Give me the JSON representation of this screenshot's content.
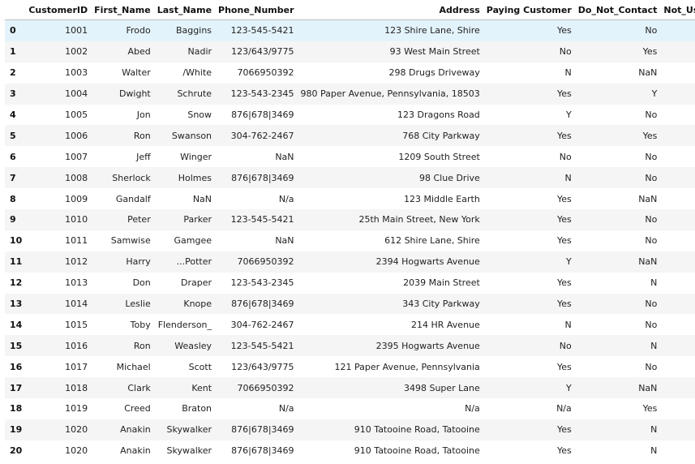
{
  "table": {
    "columns": [
      "",
      "CustomerID",
      "First_Name",
      "Last_Name",
      "Phone_Number",
      "Address",
      "Paying Customer",
      "Do_Not_Contact",
      "Not_Useful_Column"
    ],
    "rows": [
      {
        "index": "0",
        "cid": "1001",
        "first": "Frodo",
        "last": "Baggins",
        "phone": "123-545-5421",
        "address": "123 Shire Lane, Shire",
        "paying": "Yes",
        "dnc": "No",
        "nuc": "True"
      },
      {
        "index": "1",
        "cid": "1002",
        "first": "Abed",
        "last": "Nadir",
        "phone": "123/643/9775",
        "address": "93 West Main Street",
        "paying": "No",
        "dnc": "Yes",
        "nuc": "False"
      },
      {
        "index": "2",
        "cid": "1003",
        "first": "Walter",
        "last": "/White",
        "phone": "7066950392",
        "address": "298 Drugs Driveway",
        "paying": "N",
        "dnc": "NaN",
        "nuc": "True"
      },
      {
        "index": "3",
        "cid": "1004",
        "first": "Dwight",
        "last": "Schrute",
        "phone": "123-543-2345",
        "address": "980 Paper Avenue, Pennsylvania, 18503",
        "paying": "Yes",
        "dnc": "Y",
        "nuc": "True"
      },
      {
        "index": "4",
        "cid": "1005",
        "first": "Jon",
        "last": "Snow",
        "phone": "876|678|3469",
        "address": "123 Dragons Road",
        "paying": "Y",
        "dnc": "No",
        "nuc": "True"
      },
      {
        "index": "5",
        "cid": "1006",
        "first": "Ron",
        "last": "Swanson",
        "phone": "304-762-2467",
        "address": "768 City Parkway",
        "paying": "Yes",
        "dnc": "Yes",
        "nuc": "True"
      },
      {
        "index": "6",
        "cid": "1007",
        "first": "Jeff",
        "last": "Winger",
        "phone": "NaN",
        "address": "1209 South Street",
        "paying": "No",
        "dnc": "No",
        "nuc": "False"
      },
      {
        "index": "7",
        "cid": "1008",
        "first": "Sherlock",
        "last": "Holmes",
        "phone": "876|678|3469",
        "address": "98 Clue Drive",
        "paying": "N",
        "dnc": "No",
        "nuc": "False"
      },
      {
        "index": "8",
        "cid": "1009",
        "first": "Gandalf",
        "last": "NaN",
        "phone": "N/a",
        "address": "123 Middle Earth",
        "paying": "Yes",
        "dnc": "NaN",
        "nuc": "False"
      },
      {
        "index": "9",
        "cid": "1010",
        "first": "Peter",
        "last": "Parker",
        "phone": "123-545-5421",
        "address": "25th Main Street, New York",
        "paying": "Yes",
        "dnc": "No",
        "nuc": "True"
      },
      {
        "index": "10",
        "cid": "1011",
        "first": "Samwise",
        "last": "Gamgee",
        "phone": "NaN",
        "address": "612 Shire Lane, Shire",
        "paying": "Yes",
        "dnc": "No",
        "nuc": "True"
      },
      {
        "index": "11",
        "cid": "1012",
        "first": "Harry",
        "last": "...Potter",
        "phone": "7066950392",
        "address": "2394 Hogwarts Avenue",
        "paying": "Y",
        "dnc": "NaN",
        "nuc": "True"
      },
      {
        "index": "12",
        "cid": "1013",
        "first": "Don",
        "last": "Draper",
        "phone": "123-543-2345",
        "address": "2039 Main Street",
        "paying": "Yes",
        "dnc": "N",
        "nuc": "False"
      },
      {
        "index": "13",
        "cid": "1014",
        "first": "Leslie",
        "last": "Knope",
        "phone": "876|678|3469",
        "address": "343 City Parkway",
        "paying": "Yes",
        "dnc": "No",
        "nuc": "False"
      },
      {
        "index": "14",
        "cid": "1015",
        "first": "Toby",
        "last": "Flenderson_",
        "phone": "304-762-2467",
        "address": "214 HR Avenue",
        "paying": "N",
        "dnc": "No",
        "nuc": "False"
      },
      {
        "index": "15",
        "cid": "1016",
        "first": "Ron",
        "last": "Weasley",
        "phone": "123-545-5421",
        "address": "2395 Hogwarts Avenue",
        "paying": "No",
        "dnc": "N",
        "nuc": "False"
      },
      {
        "index": "16",
        "cid": "1017",
        "first": "Michael",
        "last": "Scott",
        "phone": "123/643/9775",
        "address": "121 Paper Avenue, Pennsylvania",
        "paying": "Yes",
        "dnc": "No",
        "nuc": "False"
      },
      {
        "index": "17",
        "cid": "1018",
        "first": "Clark",
        "last": "Kent",
        "phone": "7066950392",
        "address": "3498 Super Lane",
        "paying": "Y",
        "dnc": "NaN",
        "nuc": "True"
      },
      {
        "index": "18",
        "cid": "1019",
        "first": "Creed",
        "last": "Braton",
        "phone": "N/a",
        "address": "N/a",
        "paying": "N/a",
        "dnc": "Yes",
        "nuc": "True"
      },
      {
        "index": "19",
        "cid": "1020",
        "first": "Anakin",
        "last": "Skywalker",
        "phone": "876|678|3469",
        "address": "910 Tatooine Road, Tatooine",
        "paying": "Yes",
        "dnc": "N",
        "nuc": "True"
      },
      {
        "index": "20",
        "cid": "1020",
        "first": "Anakin",
        "last": "Skywalker",
        "phone": "876|678|3469",
        "address": "910 Tatooine Road, Tatooine",
        "paying": "Yes",
        "dnc": "N",
        "nuc": "True"
      }
    ]
  }
}
